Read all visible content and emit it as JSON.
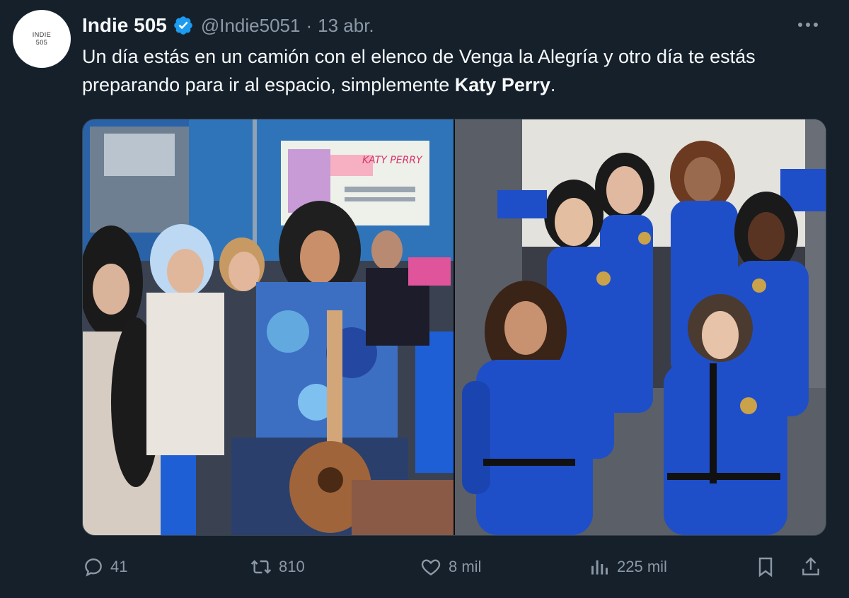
{
  "tweet": {
    "avatar_text_line1": "INDIE",
    "avatar_text_line2": "505",
    "display_name": "Indie 505",
    "handle": "@Indie5051",
    "separator": "·",
    "date": "13 abr.",
    "text_part1": "Un día estás en un camión con el elenco de Venga la Alegría y otro día te estás preparando para ir al espacio, simplemente ",
    "text_bold": "Katy Perry",
    "text_part2": "."
  },
  "media": {
    "left_poster_title": "KATY PERRY"
  },
  "actions": {
    "replies": "41",
    "retweets": "810",
    "likes": "8 mil",
    "views": "225 mil"
  },
  "colors": {
    "background": "#15202b",
    "text": "#f7f9f9",
    "muted": "#8b98a5",
    "verified": "#1d9bf0",
    "suit_blue": "#1f4fc8"
  },
  "icons": [
    "verified-badge-icon",
    "more-icon",
    "reply-icon",
    "retweet-icon",
    "like-icon",
    "views-icon",
    "bookmark-icon",
    "share-icon"
  ]
}
